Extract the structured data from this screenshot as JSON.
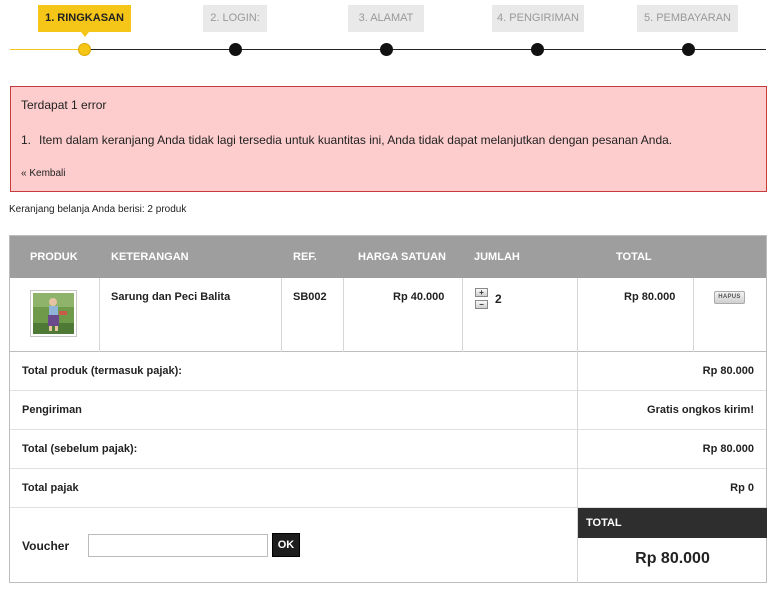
{
  "steps": [
    {
      "label": "1. RINGKASAN",
      "active": true
    },
    {
      "label": "2. LOGIN:",
      "active": false
    },
    {
      "label": "3. ALAMAT",
      "active": false
    },
    {
      "label": "4. PENGIRIMAN",
      "active": false
    },
    {
      "label": "5. PEMBAYARAN",
      "active": false
    }
  ],
  "error": {
    "title": "Terdapat 1 error",
    "item_number": "1.",
    "item_text": "Item dalam keranjang Anda tidak lagi tersedia untuk kuantitas ini, Anda tidak dapat melanjutkan dengan pesanan Anda.",
    "back_link": "« Kembali"
  },
  "cart_summary": "Keranjang belanja Anda berisi: 2 produk",
  "table": {
    "headers": {
      "product": "PRODUK",
      "description": "KETERANGAN",
      "ref": "REF.",
      "unit_price": "HARGA SATUAN",
      "qty": "JUMLAH",
      "total": "TOTAL"
    },
    "rows": [
      {
        "name": "Sarung dan Peci Balita",
        "ref": "SB002",
        "unit_price": "Rp 40.000",
        "qty": "2",
        "total": "Rp 80.000",
        "remove_label": "HAPUS",
        "qty_plus": "+",
        "qty_minus": "−"
      }
    ]
  },
  "summary": {
    "products_total": {
      "label": "Total produk (termasuk pajak):",
      "value": "Rp 80.000"
    },
    "shipping": {
      "label": "Pengiriman",
      "value": "Gratis ongkos kirim!"
    },
    "total_before_tax": {
      "label": "Total (sebelum pajak):",
      "value": "Rp 80.000"
    },
    "tax_total": {
      "label": "Total pajak",
      "value": "Rp 0"
    }
  },
  "voucher": {
    "label": "Voucher",
    "value": "",
    "button": "OK"
  },
  "grand_total": {
    "label": "TOTAL",
    "value": "Rp 80.000"
  },
  "colors": {
    "accent": "#f5c518",
    "error_bg": "#fdcccc",
    "error_border": "#c53c3c",
    "table_header": "#9e9e9e",
    "total_header": "#2e2e2e"
  }
}
